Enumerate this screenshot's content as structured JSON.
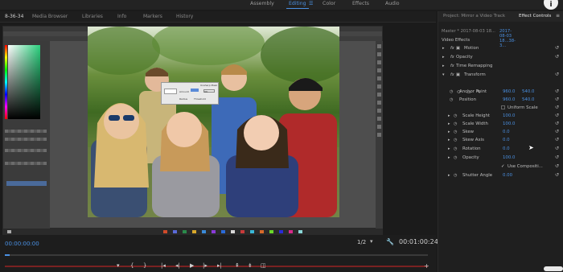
{
  "workspaces": {
    "items": [
      {
        "label": "Assembly",
        "active": false
      },
      {
        "label": "Editing",
        "active": true
      },
      {
        "label": "Color",
        "active": false
      },
      {
        "label": "Effects",
        "active": false
      },
      {
        "label": "Audio",
        "active": false
      }
    ],
    "menu_icon": "hamburger-icon"
  },
  "left_panel_tabs": [
    "8-36-34",
    "Media Browser",
    "Libraries",
    "Info",
    "Markers",
    "History"
  ],
  "program_monitor": {
    "timecode_left": "00:00:00:00",
    "fraction": "1/2",
    "timecode_right": "00:01:00:24",
    "transport_icons": [
      "marker-icon",
      "in-point-icon",
      "out-point-icon",
      "go-to-in-icon",
      "step-back-icon",
      "play-icon",
      "step-forward-icon",
      "go-to-out-icon",
      "lift-icon",
      "extract-icon",
      "export-frame-icon"
    ],
    "accent": "#4a90e2"
  },
  "photoshop": {
    "dialog_lines": [
      "Unsharp Mask",
      "Amount",
      "Radius",
      "Threshold"
    ],
    "dialog_buttons": [
      "OK",
      "Cancel"
    ]
  },
  "effect_controls": {
    "tabs": [
      "Project: Mirror a Video Track",
      "Effect Controls"
    ],
    "active_tab": "Effect Controls",
    "menu_icon": "menu-lines-icon",
    "master_label": "Master * 2017-08-03 18...",
    "sequence_label": "2017-08-03 18...38-3...",
    "video_effects_heading": "Video Effects",
    "effects": [
      {
        "name": "Motion",
        "fx": "fx",
        "expanded": false
      },
      {
        "name": "Opacity",
        "fx": "fx",
        "expanded": false
      },
      {
        "name": "Time Remapping",
        "fx": "",
        "expanded": false
      },
      {
        "name": "Transform",
        "fx": "fx",
        "expanded": true
      }
    ],
    "transform_params": [
      {
        "name": "Anchor Point",
        "value": "960.0",
        "value2": "540.0"
      },
      {
        "name": "Position",
        "value": "960.0",
        "value2": "540.0"
      },
      {
        "name": "",
        "value": "",
        "value2": "",
        "checkbox_label": "Uniform Scale"
      },
      {
        "name": "Scale Height",
        "value": "100.0",
        "value2": ""
      },
      {
        "name": "Scale Width",
        "value": "100.0",
        "value2": ""
      },
      {
        "name": "Skew",
        "value": "0.0",
        "value2": ""
      },
      {
        "name": "Skew Axis",
        "value": "0.0",
        "value2": ""
      },
      {
        "name": "Rotation",
        "value": "0.0",
        "value2": ""
      },
      {
        "name": "Opacity",
        "value": "100.0",
        "value2": ""
      },
      {
        "name": "",
        "value": "",
        "value2": "",
        "checkbox_label": "Use Compositi..."
      },
      {
        "name": "Shutter Angle",
        "value": "0.00",
        "value2": ""
      }
    ]
  },
  "colors": {
    "accent": "#4a90e2",
    "panel_bg": "#1f1f1f",
    "ps_bg": "#4e4e4e"
  }
}
